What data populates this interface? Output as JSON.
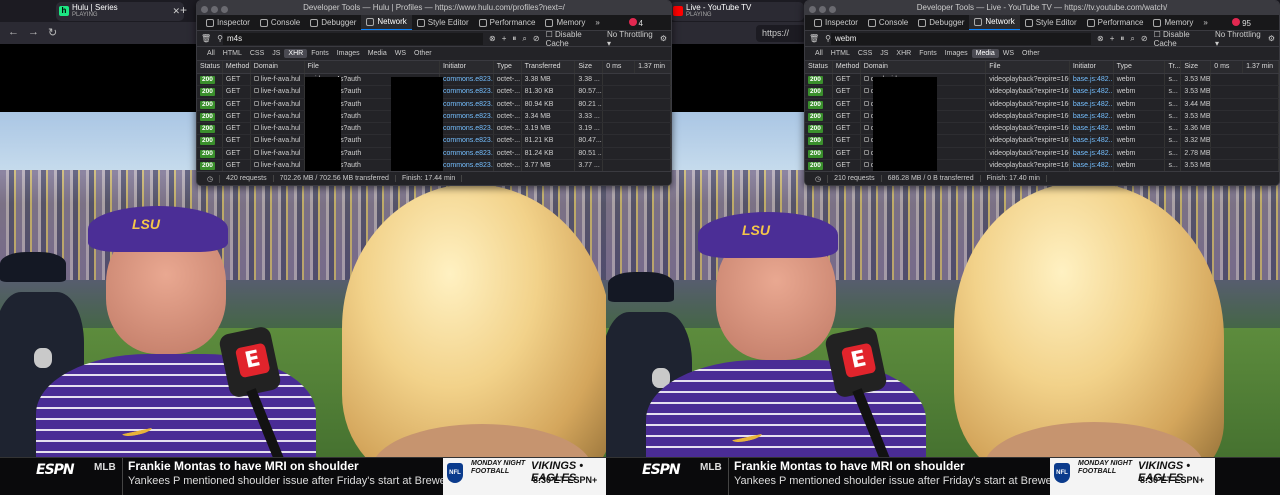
{
  "left": {
    "tab": {
      "title": "Hulu | Series",
      "status": "PLAYING",
      "favicon": "h"
    },
    "url": "https://"
  },
  "right": {
    "tab": {
      "title": "Live - YouTube TV",
      "status": "PLAYING"
    },
    "url": "https://"
  },
  "devtools_left": {
    "title": "Developer Tools — Hulu | Profiles — https://www.hulu.com/profiles?next=/",
    "tabs": [
      "Inspector",
      "Console",
      "Debugger",
      "Network",
      "Style Editor",
      "Performance",
      "Memory"
    ],
    "active_tab": "Network",
    "errors": "4",
    "filter": "m4s",
    "disable_cache": "Disable Cache",
    "throttling": "No Throttling",
    "types": [
      "All",
      "HTML",
      "CSS",
      "JS",
      "XHR",
      "Fonts",
      "Images",
      "Media",
      "WS",
      "Other"
    ],
    "active_type": "XHR",
    "columns": [
      "Status",
      "Method",
      "Domain",
      "File",
      "Initiator",
      "Type",
      "Transferred",
      "Size",
      "0 ms",
      "1.37 min"
    ],
    "rows": [
      {
        "status": "200",
        "method": "GET",
        "domain": "live-f-ava.hul",
        "file": "_video.m4s?auth",
        "initiator": "commons.e823...",
        "type": "octet-...",
        "transferred": "3.38 MB",
        "size": "3.38 ..."
      },
      {
        "status": "200",
        "method": "GET",
        "domain": "live-f-ava.hul",
        "file": "_audio.m4s?auth",
        "initiator": "commons.e823...",
        "type": "octet-...",
        "transferred": "81.30 KB",
        "size": "80.57..."
      },
      {
        "status": "200",
        "method": "GET",
        "domain": "live-f-ava.hul",
        "file": "_audio.m4s?auth",
        "initiator": "commons.e823...",
        "type": "octet-...",
        "transferred": "80.94 KB",
        "size": "80.21 ..."
      },
      {
        "status": "200",
        "method": "GET",
        "domain": "live-f-ava.hul",
        "file": "_video.m4s?auth",
        "initiator": "commons.e823...",
        "type": "octet-...",
        "transferred": "3.34 MB",
        "size": "3.33 ..."
      },
      {
        "status": "200",
        "method": "GET",
        "domain": "live-f-ava.hul",
        "file": "_video.m4s?auth",
        "initiator": "commons.e823...",
        "type": "octet-...",
        "transferred": "3.19 MB",
        "size": "3.19 ..."
      },
      {
        "status": "200",
        "method": "GET",
        "domain": "live-f-ava.hul",
        "file": "_audio.m4s?auth",
        "initiator": "commons.e823...",
        "type": "octet-...",
        "transferred": "81.21 KB",
        "size": "80.47..."
      },
      {
        "status": "200",
        "method": "GET",
        "domain": "live-f-ava.hul",
        "file": "_audio.m4s?auth",
        "initiator": "commons.e823...",
        "type": "octet-...",
        "transferred": "81.24 KB",
        "size": "80.51 ..."
      },
      {
        "status": "200",
        "method": "GET",
        "domain": "live-f-ava.hul",
        "file": "_video.m4s?auth",
        "initiator": "commons.e823...",
        "type": "octet-...",
        "transferred": "3.77 MB",
        "size": "3.77 ..."
      }
    ],
    "footer": {
      "requests": "420 requests",
      "transferred": "702.26 MB / 702.56 MB transferred",
      "finish": "Finish: 17.44 min"
    }
  },
  "devtools_right": {
    "title": "Developer Tools — Live - YouTube TV — https://tv.youtube.com/watch/",
    "tabs": [
      "Inspector",
      "Console",
      "Debugger",
      "Network",
      "Style Editor",
      "Performance",
      "Memory"
    ],
    "active_tab": "Network",
    "errors": "95",
    "filter": "webm",
    "disable_cache": "Disable Cache",
    "throttling": "No Throttling",
    "types": [
      "All",
      "HTML",
      "CSS",
      "JS",
      "XHR",
      "Fonts",
      "Images",
      "Media",
      "WS",
      "Other"
    ],
    "active_type": "Media",
    "columns": [
      "Status",
      "Method",
      "Domain",
      "File",
      "Initiator",
      "Type",
      "Tr...",
      "Size",
      "0 ms",
      "1.37 min"
    ],
    "rows": [
      {
        "status": "200",
        "method": "GET",
        "domain": "ooglevideo.com",
        "file": "videoplayback?expire=16634",
        "initiator": "base.js:482...",
        "type": "webm",
        "transferred": "s...",
        "size": "3.53 MB"
      },
      {
        "status": "200",
        "method": "GET",
        "domain": "ooglevideo.com",
        "file": "videoplayback?expire=16634",
        "initiator": "base.js:482...",
        "type": "webm",
        "transferred": "s...",
        "size": "3.53 MB"
      },
      {
        "status": "200",
        "method": "GET",
        "domain": "ooglevideo.com",
        "file": "videoplayback?expire=16634",
        "initiator": "base.js:482...",
        "type": "webm",
        "transferred": "s...",
        "size": "3.44 MB"
      },
      {
        "status": "200",
        "method": "GET",
        "domain": "ooglevideo.com",
        "file": "videoplayback?expire=16634",
        "initiator": "base.js:482...",
        "type": "webm",
        "transferred": "s...",
        "size": "3.53 MB"
      },
      {
        "status": "200",
        "method": "GET",
        "domain": "ooglevideo.com",
        "file": "videoplayback?expire=16634",
        "initiator": "base.js:482...",
        "type": "webm",
        "transferred": "s...",
        "size": "3.36 MB"
      },
      {
        "status": "200",
        "method": "GET",
        "domain": "ooglevideo.com",
        "file": "videoplayback?expire=16634",
        "initiator": "base.js:482...",
        "type": "webm",
        "transferred": "s...",
        "size": "3.32 MB"
      },
      {
        "status": "200",
        "method": "GET",
        "domain": "ooglevideo.com",
        "file": "videoplayback?expire=16634",
        "initiator": "base.js:482...",
        "type": "webm",
        "transferred": "s...",
        "size": "2.78 MB"
      },
      {
        "status": "200",
        "method": "GET",
        "domain": "ooglevideo.com",
        "file": "videoplayback?expire=16634",
        "initiator": "base.js:482...",
        "type": "webm",
        "transferred": "s...",
        "size": "3.53 MB"
      }
    ],
    "footer": {
      "requests": "210 requests",
      "transferred": "686.28 MB / 0 B transferred",
      "finish": "Finish: 17.40 min"
    }
  },
  "ticker": {
    "network": "ESPN",
    "league": "MLB",
    "headline": "Frankie Montas to have MRI on shoulder",
    "subline": "Yankees P mentioned shoulder issue after Friday's start at Brewers",
    "promo": {
      "league_badge": "NFL",
      "show": "MONDAY NIGHT FOOTBALL",
      "teams": "VIKINGS • EAGLES",
      "time": "8:30 ET ESPN+"
    }
  },
  "broadcast": {
    "visor_text": "LSU",
    "mic_logo": "E"
  }
}
